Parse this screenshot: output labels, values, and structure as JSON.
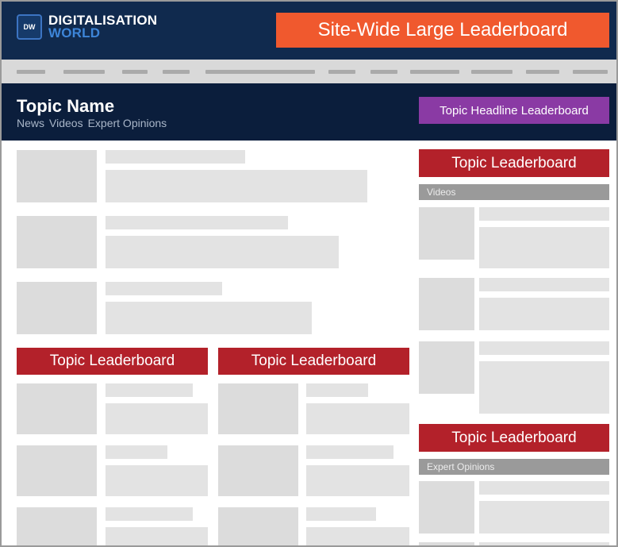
{
  "header": {
    "logo_badge": "DW",
    "logo_line1": "DIGITALISATION",
    "logo_line2": "WORLD",
    "site_leaderboard": "Site-Wide Large Leaderboard"
  },
  "topic": {
    "title": "Topic Name",
    "links": [
      "News",
      "Videos",
      "Expert Opinions"
    ],
    "headline_leaderboard": "Topic Headline Leaderboard"
  },
  "main": {
    "leaderboard_left": "Topic Leaderboard",
    "leaderboard_mid": "Topic Leaderboard"
  },
  "sidebar": {
    "leaderboard_top": "Topic Leaderboard",
    "videos_label": "Videos",
    "leaderboard_bottom": "Topic Leaderboard",
    "expert_label": "Expert Opinions"
  },
  "colors": {
    "header_bg": "#102a4e",
    "topic_bg": "#0b1e3c",
    "site_leaderboard": "#f0592e",
    "headline_leaderboard": "#8a3aa4",
    "topic_leaderboard": "#b3212a",
    "section_label": "#9a9a9a"
  }
}
